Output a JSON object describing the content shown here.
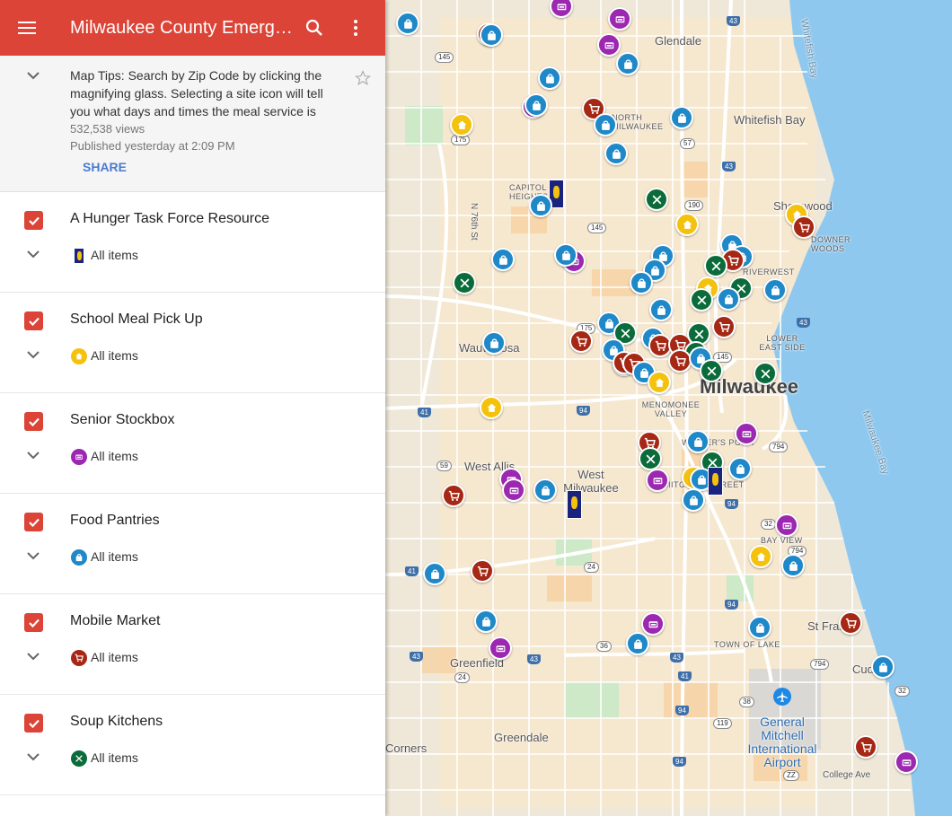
{
  "header": {
    "title": "Milwaukee County Emergency Food Resources"
  },
  "info": {
    "description": "Map Tips: Search by Zip Code by clicking the magnifying glass. Selecting a site icon will tell you what days and times the meal service is",
    "views": "532,538 views",
    "published": "Published yesterday at 2:09 PM",
    "share_label": "SHARE"
  },
  "layers": [
    {
      "title": "A Hunger Task Force Resource",
      "items_label": "All items",
      "icon": "hunger-task-force-icon",
      "color": "#1a237e"
    },
    {
      "title": "School Meal Pick Up",
      "items_label": "All items",
      "icon": "school-icon",
      "color": "#f4c20d"
    },
    {
      "title": "Senior Stockbox",
      "items_label": "All items",
      "icon": "stockbox-icon",
      "color": "#9c27b0"
    },
    {
      "title": "Food Pantries",
      "items_label": "All items",
      "icon": "pantry-bag-icon",
      "color": "#1e88c8"
    },
    {
      "title": "Mobile Market",
      "items_label": "All items",
      "icon": "shopping-cart-icon",
      "color": "#a52714"
    },
    {
      "title": "Soup Kitchens",
      "items_label": "All items",
      "icon": "fork-knife-icon",
      "color": "#0b6b3a"
    }
  ],
  "map": {
    "place_labels": {
      "glendale": "Glendale",
      "whitefish_bay": "Whitefish Bay",
      "shorewood": "Shorewood",
      "wauwatosa": "Wauwatosa",
      "milwaukee": "Milwaukee",
      "west_allis": "West Allis",
      "west_milwaukee": "West Milwaukee",
      "greenfield": "Greenfield",
      "greendale": "Greendale",
      "st_francis": "St Francis",
      "cudahy": "Cudahy",
      "corners": "Corners",
      "capitol_heights": "CAPITOL HEIGHTS",
      "north_milwaukee": "NORTH MILWAUKEE",
      "downer_woods": "DOWNER WOODS",
      "riverwest": "RIVERWEST",
      "lower_east_side": "LOWER EAST SIDE",
      "menomonee_valley": "MENOMONEE VALLEY",
      "walkers_point": "WALKER'S POINT",
      "mitchell_street": "MITCHELL STREET",
      "bay_view": "BAY VIEW",
      "town_of_lake": "TOWN OF LAKE",
      "college_ave": "College Ave",
      "n76th": "N 76th St",
      "airport": "General Mitchell International Airport",
      "whitefish_bay_water": "Whitefish Bay",
      "milwaukee_bay_water": "Milwaukee Bay"
    },
    "road_shields": [
      "145",
      "175",
      "57",
      "190",
      "43",
      "94",
      "794",
      "41",
      "59",
      "24",
      "36",
      "32",
      "38",
      "119",
      "ZZ"
    ],
    "colors": {
      "land": "#efe8d8",
      "water": "#8fc8ef",
      "road": "#ffffff",
      "urban": "#f7c88e",
      "park": "#cde9c8"
    }
  }
}
